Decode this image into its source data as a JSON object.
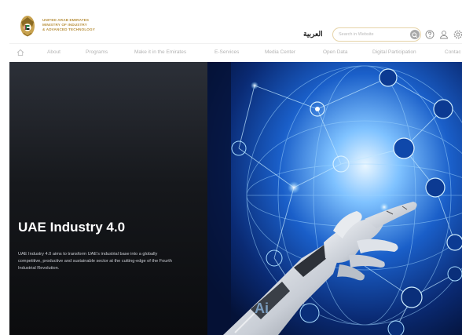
{
  "header": {
    "logo_lines": [
      "UNITED ARAB EMIRATES",
      "MINISTRY OF INDUSTRY",
      "& ADVANCED TECHNOLOGY"
    ],
    "language_link": "العربية",
    "search": {
      "placeholder": "Search in Website"
    },
    "icons": [
      "emblem-icon",
      "search-icon",
      "help-icon",
      "user-icon",
      "settings-icon"
    ]
  },
  "nav": {
    "home_icon": "home-icon",
    "items": [
      "About",
      "Programs",
      "Make it in the Emirates",
      "E-Services",
      "Media Center",
      "Open Data",
      "Digital Participation",
      "Contac"
    ]
  },
  "hero": {
    "title": "UAE Industry 4.0",
    "description": "UAE Industry 4.0 aims to transform UAE's industrial base into a globally competitive, productive and sustainable sector at the cutting-edge of the Fourth Industrial Revolution.",
    "image": "robot-hand-digital-network-image"
  },
  "colors": {
    "gold": "#b8903c",
    "nav_text": "#b3b3b3",
    "hero_dark": "#16181c",
    "network_blue": "#4aa8ff"
  }
}
